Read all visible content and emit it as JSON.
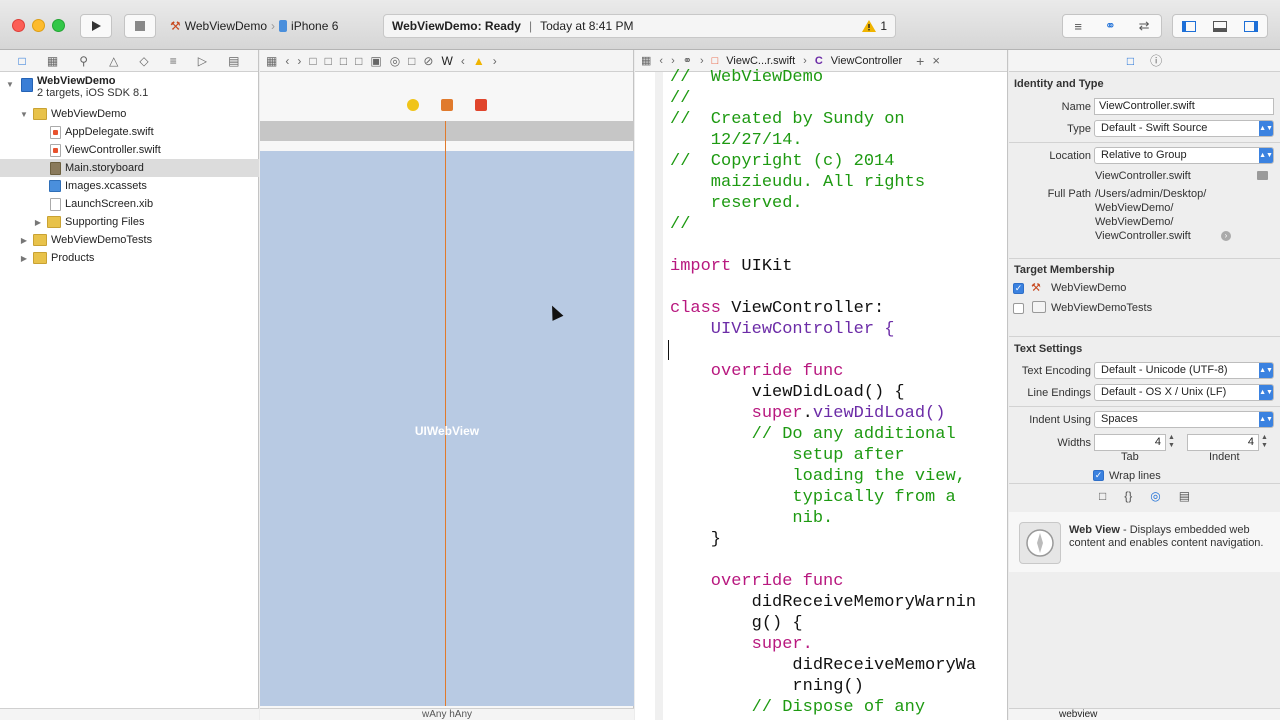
{
  "toolbar": {
    "run_icon": "play-icon",
    "stop_icon": "stop-icon",
    "scheme_target": "WebViewDemo",
    "scheme_device": "iPhone 6",
    "activity_status": "WebViewDemo: Ready",
    "activity_time": "Today at 8:41 PM",
    "warning_count": "1"
  },
  "navigator": {
    "project_name": "WebViewDemo",
    "project_subtitle": "2 targets, iOS SDK 8.1",
    "items": [
      {
        "label": "WebViewDemo",
        "kind": "folder"
      },
      {
        "label": "AppDelegate.swift",
        "kind": "swift"
      },
      {
        "label": "ViewController.swift",
        "kind": "swift"
      },
      {
        "label": "Main.storyboard",
        "kind": "storyboard"
      },
      {
        "label": "Images.xcassets",
        "kind": "xcassets"
      },
      {
        "label": "LaunchScreen.xib",
        "kind": "xib"
      },
      {
        "label": "Supporting Files",
        "kind": "folder"
      },
      {
        "label": "WebViewDemoTests",
        "kind": "folder"
      },
      {
        "label": "Products",
        "kind": "folder"
      }
    ]
  },
  "ib": {
    "jump_tail": "W",
    "view_label": "UIWebView",
    "size_class": "wAny hAny"
  },
  "editor": {
    "file_crumb": "ViewC...r.swift",
    "class_crumb": "ViewController",
    "code_lines": [
      {
        "t": "//  WebViewDemo",
        "c": "com"
      },
      {
        "t": "//",
        "c": "com"
      },
      {
        "t": "//  Created by Sundy on",
        "c": "com"
      },
      {
        "t": "    12/27/14.",
        "c": "com"
      },
      {
        "t": "//  Copyright (c) 2014",
        "c": "com"
      },
      {
        "t": "    maizieudu. All rights",
        "c": "com"
      },
      {
        "t": "    reserved.",
        "c": "com"
      },
      {
        "t": "//",
        "c": "com"
      },
      {
        "t": "",
        "c": "tx"
      },
      {
        "t": "import UIKit",
        "c": "import"
      },
      {
        "t": "",
        "c": "tx"
      },
      {
        "t": "class ViewController:",
        "c": "class"
      },
      {
        "t": "    UIViewController {",
        "c": "ty"
      },
      {
        "t": "",
        "c": "tx"
      },
      {
        "t": "    override func",
        "c": "kw"
      },
      {
        "t": "        viewDidLoad() {",
        "c": "tx"
      },
      {
        "t": "        super.viewDidLoad()",
        "c": "super"
      },
      {
        "t": "        // Do any additional",
        "c": "com"
      },
      {
        "t": "            setup after",
        "c": "com"
      },
      {
        "t": "            loading the view,",
        "c": "com"
      },
      {
        "t": "            typically from a",
        "c": "com"
      },
      {
        "t": "            nib.",
        "c": "com"
      },
      {
        "t": "    }",
        "c": "tx"
      },
      {
        "t": "",
        "c": "tx"
      },
      {
        "t": "    override func",
        "c": "kw"
      },
      {
        "t": "        didReceiveMemoryWarnin",
        "c": "tx"
      },
      {
        "t": "        g() {",
        "c": "tx"
      },
      {
        "t": "        super.",
        "c": "kw"
      },
      {
        "t": "            didReceiveMemoryWa",
        "c": "tx"
      },
      {
        "t": "            rning()",
        "c": "tx"
      },
      {
        "t": "        // Dispose of any",
        "c": "com"
      }
    ]
  },
  "inspector": {
    "identity_title": "Identity and Type",
    "name_label": "Name",
    "name_value": "ViewController.swift",
    "type_label": "Type",
    "type_value": "Default - Swift Source",
    "location_label": "Location",
    "location_value": "Relative to Group",
    "location_file": "ViewController.swift",
    "fullpath_label": "Full Path",
    "fullpath_lines": [
      "/Users/admin/Desktop/",
      "WebViewDemo/",
      "WebViewDemo/",
      "ViewController.swift"
    ],
    "target_title": "Target Membership",
    "targets": [
      {
        "label": "WebViewDemo",
        "checked": true
      },
      {
        "label": "WebViewDemoTests",
        "checked": false
      }
    ],
    "text_title": "Text Settings",
    "encoding_label": "Text Encoding",
    "encoding_value": "Default - Unicode (UTF-8)",
    "endings_label": "Line Endings",
    "endings_value": "Default - OS X / Unix (LF)",
    "indent_label": "Indent Using",
    "indent_value": "Spaces",
    "widths_label": "Widths",
    "tab_width": "4",
    "indent_width": "4",
    "tab_caption": "Tab",
    "indent_caption": "Indent",
    "wrap_label": "Wrap lines",
    "library_title": "Web View",
    "library_desc_1": " - Displays embedded web",
    "library_desc_2": "content and enables content navigation.",
    "filter_value": "webview"
  },
  "colors": {
    "accent": "#3b82e0",
    "comment": "#1e9a12",
    "keyword": "#b8187f",
    "type": "#6c2ca7",
    "canvas": "#b8cae3",
    "guide": "#e07a2c"
  }
}
